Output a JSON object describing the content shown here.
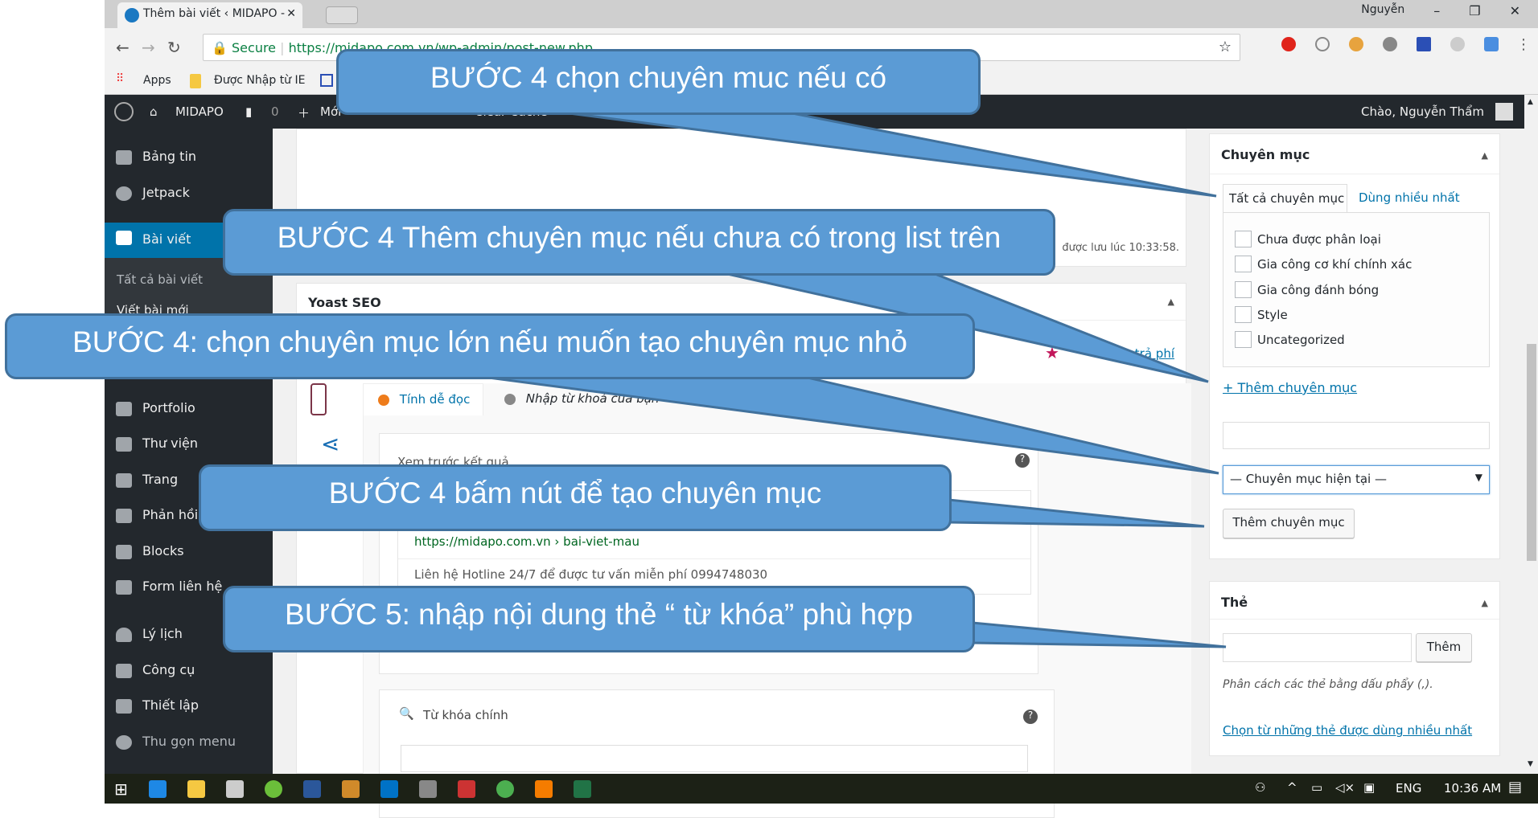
{
  "browser": {
    "tab_title": "Thêm bài viết ‹ MIDAPO -",
    "user": "Nguyễn",
    "secure_label": "Secure",
    "url": "https://midapo.com.vn/wp-admin/post-new.php",
    "bookmarks": [
      "Apps",
      "Được Nhập từ IE"
    ]
  },
  "adminbar": {
    "site": "MIDAPO",
    "comments": "0",
    "new": "Mới",
    "cache": "Clear Cache",
    "greeting": "Chào, Nguyễn Thẩm"
  },
  "sidebar": {
    "items": [
      {
        "label": "Bảng tin",
        "icon": "dashboard-icon"
      },
      {
        "label": "Jetpack",
        "icon": "jetpack-icon"
      },
      {
        "label": "Bài viết",
        "icon": "pin-icon",
        "active": true
      },
      {
        "label": "Portfolio",
        "icon": "folder-icon"
      },
      {
        "label": "Thư viện",
        "icon": "media-icon"
      },
      {
        "label": "Trang",
        "icon": "pages-icon"
      },
      {
        "label": "Phản hồi",
        "icon": "comment-icon"
      },
      {
        "label": "Blocks",
        "icon": "blocks-icon"
      },
      {
        "label": "Form liên hệ",
        "icon": "mail-icon"
      },
      {
        "label": "Lý lịch",
        "icon": "user-icon"
      },
      {
        "label": "Công cụ",
        "icon": "wrench-icon"
      },
      {
        "label": "Thiết lập",
        "icon": "settings-icon"
      },
      {
        "label": "Thu gọn menu",
        "icon": "collapse-icon"
      }
    ],
    "submenu": [
      "Tất cả bài viết",
      "Viết bài mới"
    ]
  },
  "editor": {
    "saved": "được lưu lúc 10:33:58.",
    "yoast_title": "Yoast SEO",
    "premium_link": "ấp trả phí",
    "tabs": [
      "Tính dễ đọc",
      "Nhập từ khoá của bạn"
    ],
    "preview_label": "Xem trước kết quả",
    "preview_url": "https://midapo.com.vn › bai-viet-mau",
    "preview_desc": "Liên hệ Hotline 24/7 để được tư vấn miễn phí 0994748030",
    "focus_kw_label": "Từ khóa chính"
  },
  "categories": {
    "title": "Chuyên mục",
    "tab_all": "Tất cả chuyên mục",
    "tab_popular": "Dùng nhiều nhất",
    "items": [
      "Chưa được phân loại",
      "Gia công cơ khí chính xác",
      "Gia công đánh bóng",
      "Style",
      "Uncategorized"
    ],
    "add_link": "+ Thêm chuyên mục",
    "parent_select": "— Chuyên mục hiện tại —",
    "add_button": "Thêm chuyên mục"
  },
  "tags": {
    "title": "Thẻ",
    "add_button": "Thêm",
    "hint": "Phân cách các thẻ bằng dấu phẩy (,).",
    "popular_link": "Chọn từ những thẻ được dùng nhiều nhất"
  },
  "taskbar": {
    "lang": "ENG",
    "time": "10:36 AM"
  },
  "callouts": [
    "BƯỚC 4 chọn chuyên muc nếu có",
    "BƯỚC 4 Thêm chuyên mục nếu chưa có trong list trên",
    "BƯỚC 4: chọn chuyên mục lớn nếu muốn tạo chuyên mục nhỏ",
    "BƯỚC 4 bấm nút để tạo chuyên mục",
    "BƯỚC 5: nhập nội dung thẻ “ từ khóa” phù hợp"
  ],
  "colors": {
    "callout": "#5b9bd5",
    "callout_border": "#41719c",
    "wp_dark": "#23282d",
    "wp_blue": "#0073aa"
  }
}
